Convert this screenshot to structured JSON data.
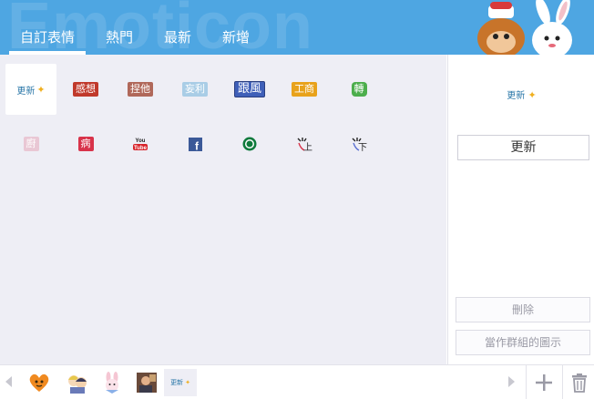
{
  "header": {
    "watermark": "Emoticon",
    "background": "#4ea6e2",
    "tabs": [
      {
        "label": "自訂表情",
        "active": true
      },
      {
        "label": "熱門",
        "active": false
      },
      {
        "label": "最新",
        "active": false
      },
      {
        "label": "新增",
        "active": false
      }
    ],
    "mascot_icon": "monkey-and-rabbit-mascot"
  },
  "stickers": {
    "row1": [
      {
        "label": "更新",
        "icon": "sparkle",
        "selected": true
      },
      {
        "label": "感想",
        "color": "#c0392b"
      },
      {
        "label": "捏他",
        "color": "#b0685a"
      },
      {
        "label": "妄利",
        "color": "#a9cde6"
      },
      {
        "label": "跟風",
        "color": "#3f5fb8"
      },
      {
        "label": "工商",
        "color": "#e8a21b"
      },
      {
        "label": "轉",
        "color": "#4cae4c"
      }
    ],
    "row2": [
      {
        "label": "廚",
        "color": "#e9c7d4"
      },
      {
        "label": "病",
        "color": "#d8334a"
      },
      {
        "label": "You Tube",
        "icon": "youtube-logo"
      },
      {
        "label": "f",
        "icon": "facebook-logo",
        "color": "#3b5998"
      },
      {
        "label": "",
        "icon": "starbucks-logo"
      },
      {
        "label": "上",
        "icon": "pointing-up"
      },
      {
        "label": "下",
        "icon": "pointing-down"
      }
    ]
  },
  "right_panel": {
    "preview_label": "更新",
    "name_value": "更新",
    "delete_label": "刪除",
    "set_group_icon_label": "當作群組的圖示"
  },
  "bottom_bar": {
    "packs": [
      "orange-heart-face",
      "anime-couple",
      "bunny-ears-girl",
      "photo-person",
      "update-sticker"
    ],
    "selected_pack_label": "更新",
    "add_icon": "plus-icon",
    "trash_icon": "trash-icon"
  }
}
